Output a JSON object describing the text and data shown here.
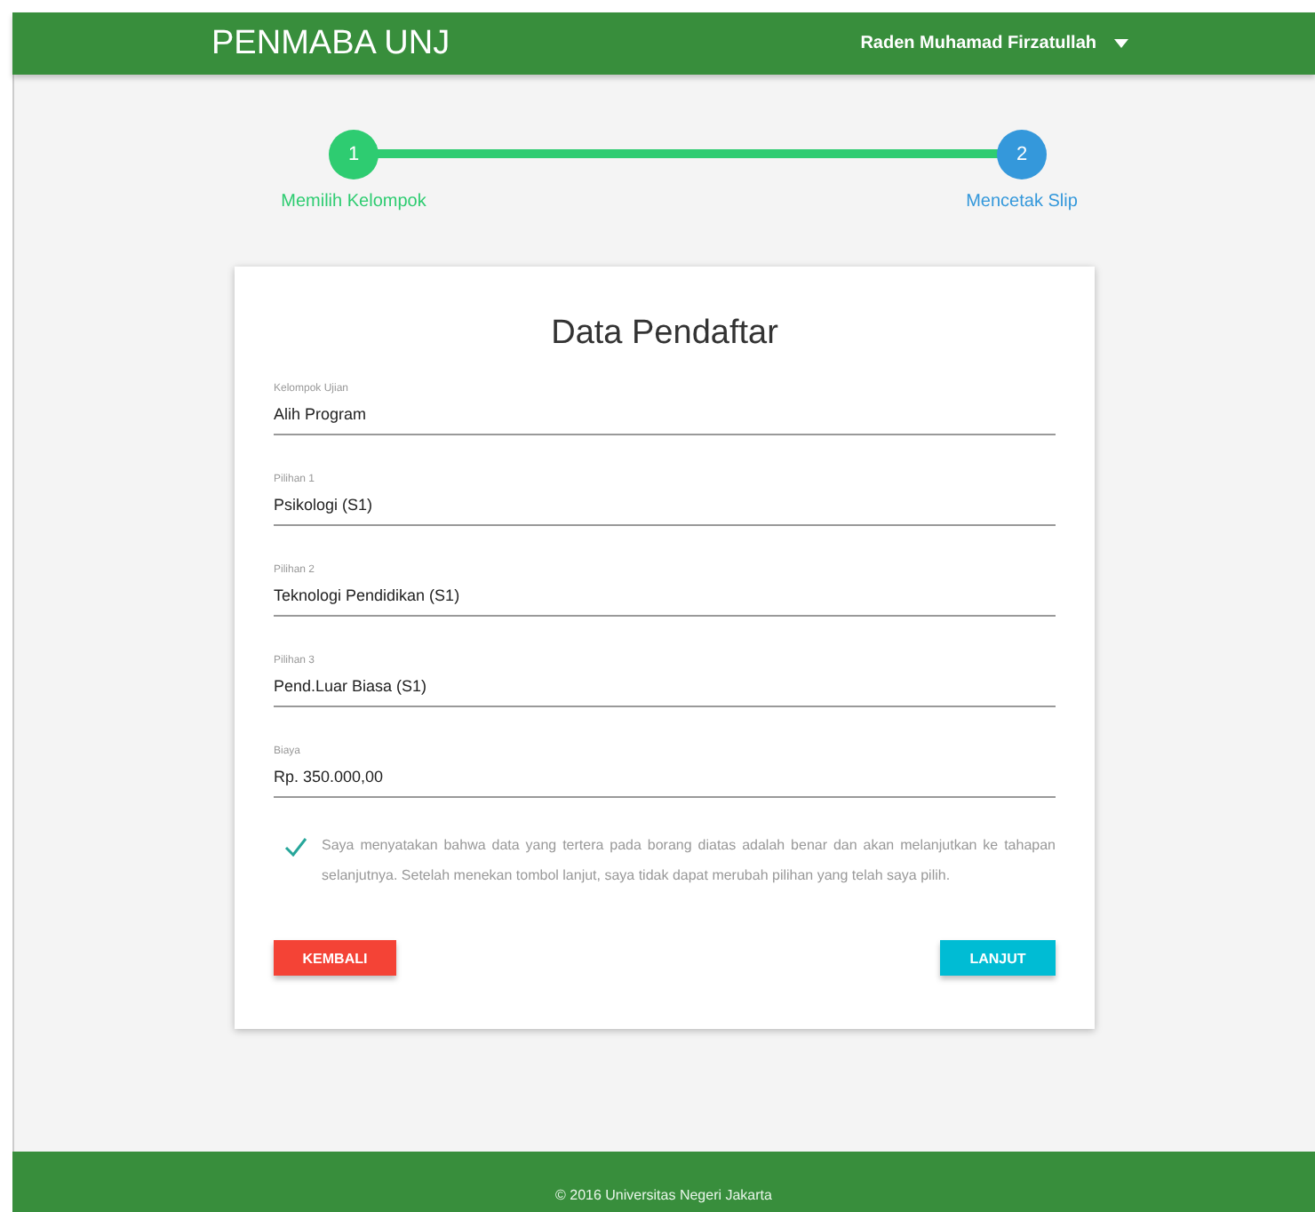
{
  "navbar": {
    "brand": "PENMABA UNJ",
    "user": "Raden Muhamad Firzatullah"
  },
  "steps": [
    {
      "number": "1",
      "label": "Memilih Kelompok",
      "selected": false
    },
    {
      "number": "2",
      "label": "Mencetak Slip",
      "selected": true
    }
  ],
  "card": {
    "title": "Data Pendaftar",
    "fields": [
      {
        "label": "Kelompok Ujian",
        "value": "Alih Program"
      },
      {
        "label": "Pilihan 1",
        "value": "Psikologi (S1)"
      },
      {
        "label": "Pilihan 2",
        "value": "Teknologi Pendidikan (S1)"
      },
      {
        "label": "Pilihan 3",
        "value": "Pend.Luar Biasa (S1)"
      },
      {
        "label": "Biaya",
        "value": "Rp. 350.000,00"
      }
    ],
    "agreement": {
      "checked": true,
      "text": "Saya menyatakan bahwa data yang tertera pada borang diatas adalah benar dan akan melanjutkan ke tahapan selanjutnya. Setelah menekan tombol lanjut, saya tidak dapat merubah pilihan yang telah saya pilih."
    },
    "buttons": [
      {
        "label": "KEMBALI",
        "kind": "back"
      },
      {
        "label": "LANJUT",
        "kind": "next"
      }
    ]
  },
  "footer": {
    "text": "© 2016 Universitas Negeri Jakarta"
  }
}
